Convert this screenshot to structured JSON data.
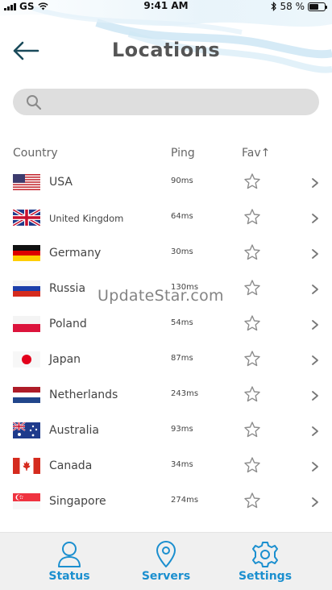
{
  "status_bar": {
    "carrier": "GS",
    "time": "9:41 AM",
    "battery_percent": "58 %"
  },
  "header": {
    "title": "Locations"
  },
  "search": {
    "placeholder": "",
    "value": ""
  },
  "columns": {
    "country": "Country",
    "ping": "Ping",
    "fav": "Fav↑"
  },
  "locations": [
    {
      "country": "USA",
      "ping": "90ms",
      "flag": "us",
      "favorite": false
    },
    {
      "country": "United Kingdom",
      "ping": "64ms",
      "flag": "gb",
      "favorite": false
    },
    {
      "country": "Germany",
      "ping": "30ms",
      "flag": "de",
      "favorite": false
    },
    {
      "country": "Russia",
      "ping": "130ms",
      "flag": "ru",
      "favorite": false
    },
    {
      "country": "Poland",
      "ping": "54ms",
      "flag": "pl",
      "favorite": false
    },
    {
      "country": "Japan",
      "ping": "87ms",
      "flag": "jp",
      "favorite": false
    },
    {
      "country": "Netherlands",
      "ping": "243ms",
      "flag": "nl",
      "favorite": false
    },
    {
      "country": "Australia",
      "ping": "93ms",
      "flag": "au",
      "favorite": false
    },
    {
      "country": "Canada",
      "ping": "34ms",
      "flag": "ca",
      "favorite": false
    },
    {
      "country": "Singapore",
      "ping": "274ms",
      "flag": "sg",
      "favorite": false
    }
  ],
  "watermark": "UpdateStar.com",
  "tabs": [
    {
      "label": "Status",
      "icon": "person-icon"
    },
    {
      "label": "Servers",
      "icon": "location-pin-icon"
    },
    {
      "label": "Settings",
      "icon": "gear-icon"
    }
  ],
  "colors": {
    "accent": "#1b8fcf",
    "search_bg": "#dedede",
    "tabbar_bg": "#f0f0f0"
  }
}
